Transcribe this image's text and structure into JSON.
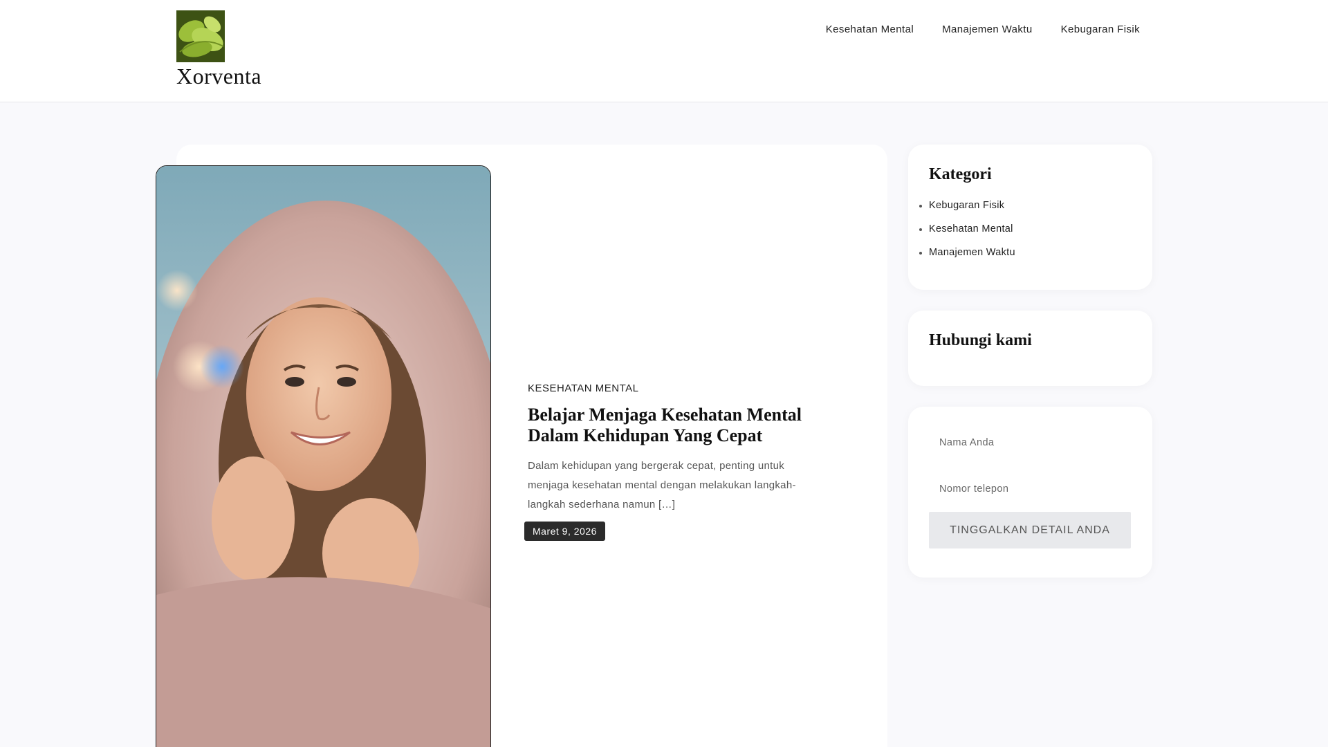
{
  "site": {
    "title": "Xorventa"
  },
  "nav": {
    "items": [
      {
        "label": "Kesehatan Mental"
      },
      {
        "label": "Manajemen Waktu"
      },
      {
        "label": "Kebugaran Fisik"
      }
    ]
  },
  "post": {
    "category": "KESEHATAN MENTAL",
    "title": "Belajar Menjaga Kesehatan Mental Dalam Kehidupan Yang Cepat",
    "excerpt": "Dalam kehidupan yang bergerak cepat, penting untuk menjaga kesehatan mental dengan melakukan langkah-langkah sederhana namun […]",
    "date": "Maret 9, 2026"
  },
  "sidebar": {
    "categories": {
      "title": "Kategori",
      "items": [
        {
          "label": "Kebugaran Fisik"
        },
        {
          "label": "Kesehatan Mental"
        },
        {
          "label": "Manajemen Waktu"
        }
      ]
    },
    "contact": {
      "title": "Hubungi kami"
    },
    "form": {
      "name_placeholder": "Nama Anda",
      "phone_placeholder": "Nomor telepon",
      "submit_label": "TINGGALKAN DETAIL ANDA"
    }
  }
}
